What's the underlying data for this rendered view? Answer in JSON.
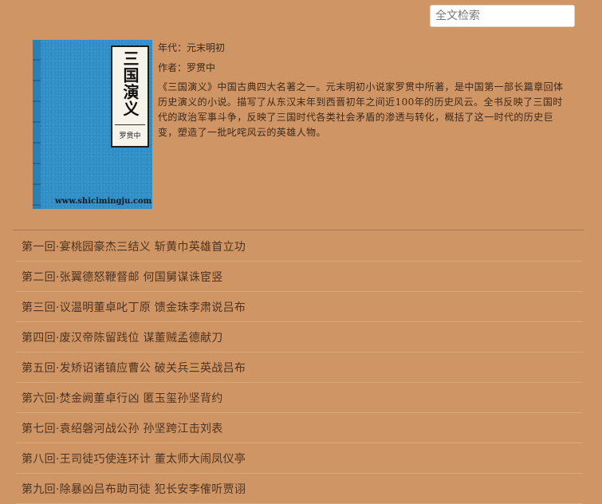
{
  "search": {
    "placeholder": "全文检索"
  },
  "book": {
    "cover_title": "三国演义",
    "cover_author": "罗贯中",
    "cover_url": "www.shicimingju.com",
    "era_line": "年代：元末明初",
    "author_line": "作者：罗贯中",
    "description": "《三国演义》中国古典四大名著之一。元末明初小说家罗贯中所著，是中国第一部长篇章回体历史演义的小说。描写了从东汉末年到西晋初年之间近100年的历史风云。全书反映了三国时代的政治军事斗争，反映了三国时代各类社会矛盾的渗透与转化，概括了这一时代的历史巨变，塑造了一批叱咤风云的英雄人物。"
  },
  "chapters": [
    "第一回·宴桃园豪杰三结义 斩黄巾英雄首立功",
    "第二回·张翼德怒鞭督邮 何国舅谋诛宦竖",
    "第三回·议温明董卓叱丁原 馈金珠李肃说吕布",
    "第四回·废汉帝陈留践位 谋董贼孟德献刀",
    "第五回·发矫诏诸镇应曹公 破关兵三英战吕布",
    "第六回·焚金阙董卓行凶 匿玉玺孙坚背约",
    "第七回·袁绍磐河战公孙 孙坚跨江击刘表",
    "第八回·王司徒巧使连环计 董太师大闹凤仪亭",
    "第九回·除暴凶吕布助司徒 犯长安李傕听贾诩"
  ],
  "colors": {
    "background": "#cf9565",
    "cover_blue": "#2f8fc6",
    "text": "#4e3421"
  }
}
